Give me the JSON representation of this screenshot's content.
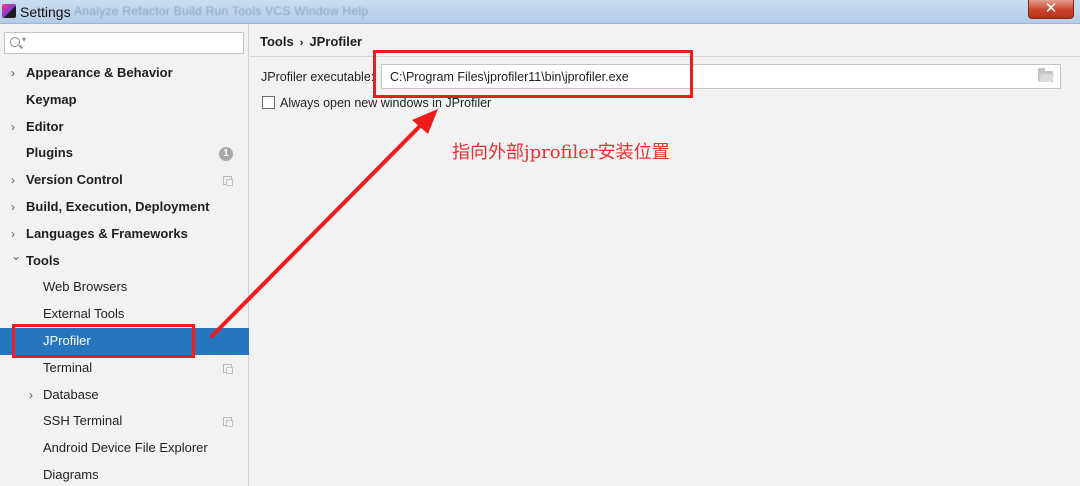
{
  "window": {
    "title": "Settings",
    "background_menu": "Analyze  Refactor  Build  Run  Tools  VCS  Window  Help",
    "close_glyph": "✕"
  },
  "search": {
    "value": "",
    "placeholder": ""
  },
  "sidebar": {
    "items": [
      {
        "label": "Appearance & Behavior",
        "expandable": true,
        "bold": true
      },
      {
        "label": "Keymap",
        "bold": true
      },
      {
        "label": "Editor",
        "expandable": true,
        "bold": true
      },
      {
        "label": "Plugins",
        "bold": true,
        "badge": "1"
      },
      {
        "label": "Version Control",
        "expandable": true,
        "bold": true
      },
      {
        "label": "Build, Execution, Deployment",
        "expandable": true,
        "bold": true
      },
      {
        "label": "Languages & Frameworks",
        "expandable": true,
        "bold": true
      },
      {
        "label": "Tools",
        "expanded": true,
        "bold": true
      },
      {
        "label": "Web Browsers"
      },
      {
        "label": "External Tools"
      },
      {
        "label": "JProfiler",
        "selected": true
      },
      {
        "label": "Terminal"
      },
      {
        "label": "Database",
        "expandable": true
      },
      {
        "label": "SSH Terminal"
      },
      {
        "label": "Android Device File Explorer"
      },
      {
        "label": "Diagrams"
      }
    ]
  },
  "main": {
    "breadcrumb": {
      "parent": "Tools",
      "separator": "›",
      "current": "JProfiler"
    },
    "executable_label": "JProfiler executable:",
    "executable_value": "C:\\Program Files\\jprofiler11\\bin\\jprofiler.exe",
    "checkbox_label": "Always open new windows in JProfiler",
    "checkbox_checked": false
  },
  "annotation": {
    "text": "指向外部jprofiler安装位置",
    "color": "#ee1c1c"
  },
  "colors": {
    "selection": "#2675bf",
    "annotation_red": "#ee1c1c"
  }
}
